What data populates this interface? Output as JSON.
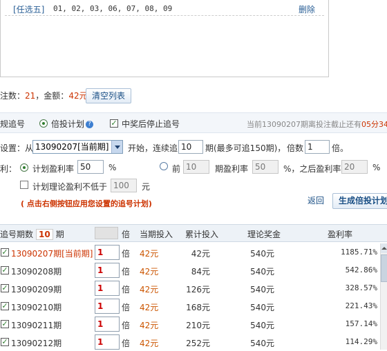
{
  "selection": {
    "play_type": "[任选五]",
    "numbers": "01, 02, 03, 06, 07, 08, 09",
    "delete_label": "删除"
  },
  "summary": {
    "bets_label": "注数：",
    "bets_value": "21",
    "amount_label": "，金额：",
    "amount_value": "42元",
    "clear_button": "清空列表"
  },
  "options": {
    "normal_chase": "规追号",
    "multiplier_plan": "倍投计划",
    "help": "?",
    "stop_on_win": "中奖后停止追号",
    "deadline_prefix": "当前13090207期离投注截止还有",
    "deadline_value": "05分34"
  },
  "settings": {
    "start_label": "设置：从",
    "start_issue": "13090207[当前期]",
    "continue_label": "开始，连续追",
    "periods_value": "10",
    "periods_suffix": "期(最多可追150期)，",
    "multiple_label": "倍数",
    "multiple_value": "1",
    "multiple_unit": "倍。",
    "profit_label": "利：",
    "plan_rate_label": "计划盈利率",
    "plan_rate_value": "50",
    "percent": "%",
    "first_label": "前",
    "first_value": "10",
    "first_rate_label": "期盈利率",
    "first_rate_value": "50",
    "after_label": "%，之后盈利率",
    "after_value": "20",
    "min_profit_label": "计划理论盈利不低于",
    "min_profit_value": "100",
    "yuan": "元",
    "hint": "( 点击右侧按钮应用您设置的追号计划)",
    "back_button": "返回",
    "generate_button": "生成倍投计划"
  },
  "table": {
    "headers": {
      "issues_prefix": "追号期数",
      "issues_count": "10",
      "issues_suffix": "期",
      "bei": "倍",
      "current": "当期投入",
      "total": "累计投入",
      "prize": "理论奖金",
      "rate": "盈利率"
    },
    "rows": [
      {
        "issue": "13090207期[当前期]",
        "multiple": "1",
        "bei": "倍",
        "current": "42元",
        "total": "42元",
        "prize": "540元",
        "rate": "1185.71%"
      },
      {
        "issue": "13090208期",
        "multiple": "1",
        "bei": "倍",
        "current": "42元",
        "total": "84元",
        "prize": "540元",
        "rate": "542.86%"
      },
      {
        "issue": "13090209期",
        "multiple": "1",
        "bei": "倍",
        "current": "42元",
        "total": "126元",
        "prize": "540元",
        "rate": "328.57%"
      },
      {
        "issue": "13090210期",
        "multiple": "1",
        "bei": "倍",
        "current": "42元",
        "total": "168元",
        "prize": "540元",
        "rate": "221.43%"
      },
      {
        "issue": "13090211期",
        "multiple": "1",
        "bei": "倍",
        "current": "42元",
        "total": "210元",
        "prize": "540元",
        "rate": "157.14%"
      },
      {
        "issue": "13090212期",
        "multiple": "1",
        "bei": "倍",
        "current": "42元",
        "total": "252元",
        "prize": "540元",
        "rate": "114.29%"
      }
    ]
  },
  "colors": {
    "accent_red": "#cc3300",
    "link_blue": "#2a5f96",
    "header_bg": "#edf2f7"
  },
  "icons": {
    "check": "check-icon",
    "help": "help-icon",
    "dropdown": "chevron-down-icon"
  }
}
